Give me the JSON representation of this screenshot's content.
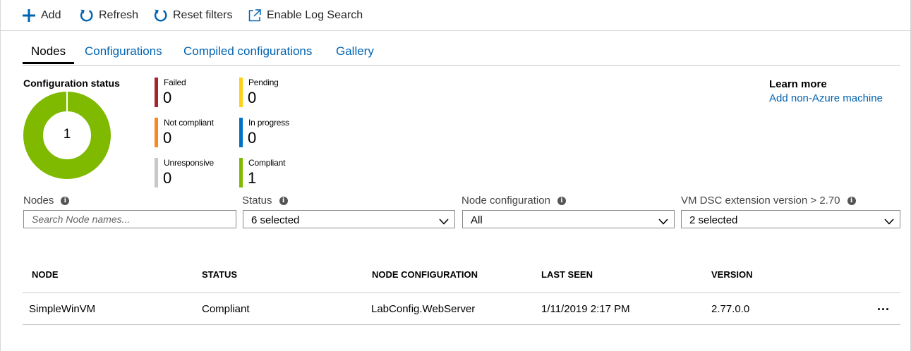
{
  "toolbar": {
    "add": {
      "label": "Add",
      "icon": "plus-icon"
    },
    "refresh": {
      "label": "Refresh",
      "icon": "refresh-icon"
    },
    "reset": {
      "label": "Reset filters",
      "icon": "reset-icon"
    },
    "log": {
      "label": "Enable Log Search",
      "icon": "external-link-icon"
    }
  },
  "tabs": [
    {
      "label": "Nodes",
      "active": true
    },
    {
      "label": "Configurations",
      "active": false
    },
    {
      "label": "Compiled configurations",
      "active": false
    },
    {
      "label": "Gallery",
      "active": false
    }
  ],
  "config_status": {
    "title": "Configuration status",
    "total": "1",
    "stats": [
      {
        "label": "Failed",
        "value": "0",
        "color": "#a4262c"
      },
      {
        "label": "Pending",
        "value": "0",
        "color": "#fcd116"
      },
      {
        "label": "Not compliant",
        "value": "0",
        "color": "#f7891d"
      },
      {
        "label": "In progress",
        "value": "0",
        "color": "#0072c6"
      },
      {
        "label": "Unresponsive",
        "value": "0",
        "color": "#c8c8c8"
      },
      {
        "label": "Compliant",
        "value": "1",
        "color": "#7fba00"
      }
    ],
    "donut_color": "#7fba00"
  },
  "learn_more": {
    "title": "Learn more",
    "link": "Add non-Azure machine"
  },
  "filters": {
    "nodes": {
      "label": "Nodes",
      "placeholder": "Search Node names..."
    },
    "status": {
      "label": "Status",
      "value": "6 selected"
    },
    "node_config": {
      "label": "Node configuration",
      "value": "All"
    },
    "dsc_version": {
      "label": "VM DSC extension version > 2.70",
      "value": "2 selected"
    }
  },
  "table": {
    "columns": [
      "NODE",
      "STATUS",
      "NODE CONFIGURATION",
      "LAST SEEN",
      "VERSION"
    ],
    "rows": [
      {
        "node": "SimpleWinVM",
        "status": "Compliant",
        "node_configuration": "LabConfig.WebServer",
        "last_seen": "1/11/2019 2:17 PM",
        "version": "2.77.0.0",
        "more": "..."
      }
    ]
  },
  "colors": {
    "accent": "#0063b1",
    "link": "#0063b1"
  }
}
